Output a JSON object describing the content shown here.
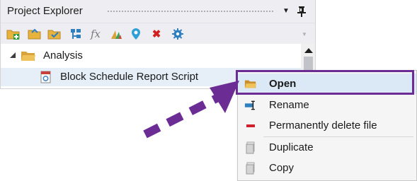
{
  "panel": {
    "title": "Project Explorer",
    "dropdown_glyph": "▼",
    "pin_icon": "pin-icon",
    "toolbar": [
      {
        "name": "add-folder-icon",
        "color": "#e8b33c"
      },
      {
        "name": "open-folder-icon",
        "color": "#e8b33c"
      },
      {
        "name": "folder-check-icon",
        "color": "#e8b33c"
      },
      {
        "name": "hierarchy-icon",
        "color": "#2f7fbf"
      },
      {
        "name": "function-icon",
        "color": "#808080"
      },
      {
        "name": "chart-icon",
        "color": "#d9a23a"
      },
      {
        "name": "map-pin-icon",
        "color": "#2f9fd6"
      },
      {
        "name": "delete-icon",
        "color": "#d02020"
      },
      {
        "name": "settings-icon",
        "color": "#2f7fbf"
      }
    ],
    "function_glyph": "fx",
    "delete_glyph": "✖"
  },
  "tree": {
    "folder": {
      "label": "Analysis",
      "icon": "folder-icon"
    },
    "item": {
      "label": "Block Schedule Report Script",
      "icon": "script-icon"
    }
  },
  "context_menu": {
    "items": [
      {
        "label": "Open",
        "icon": "open-folder-icon"
      },
      {
        "label": "Rename",
        "icon": "rename-icon"
      },
      {
        "label": "Permanently delete file",
        "icon": "delete-icon"
      },
      {
        "label": "Duplicate",
        "icon": "duplicate-icon"
      },
      {
        "label": "Copy",
        "icon": "copy-icon"
      }
    ]
  },
  "annotation": {
    "color": "#6b2d94",
    "icon": "dashed-arrow"
  }
}
